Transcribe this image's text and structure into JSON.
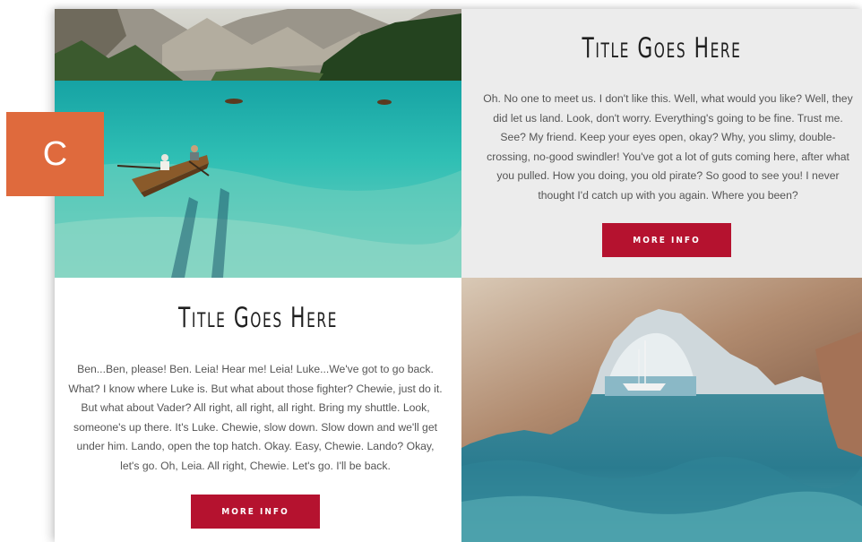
{
  "badge": {
    "letter": "C"
  },
  "sections": [
    {
      "title": "Title Goes Here",
      "body": "Oh. No one to meet us. I don't like this. Well, what would you like? Well, they did let us land. Look, don't worry. Everything's going to be fine. Trust me. See? My friend. Keep your eyes open, okay? Why, you slimy, double-crossing, no-good swindler! You've got a lot of guts coming here, after what you pulled. How you doing, you old pirate? So good to see you! I never thought I'd catch up with you again. Where you been?",
      "button": "MORE INFO"
    },
    {
      "title": "Title Goes Here",
      "body": "Ben...Ben, please! Ben. Leia! Hear me! Leia! Luke...We've got to go back. What? I know where Luke is. But what about those fighter? Chewie, just do it. But what about Vader? All right, all right, all right. Bring my shuttle. Look, someone's up there. It's Luke. Chewie, slow down. Slow down and we'll get under him. Lando, open the top hatch. Okay. Easy, Chewie. Lando? Okay, let's go. Oh, Leia. All right, Chewie. Let's go. I'll be back.",
      "button": "MORE INFO"
    }
  ],
  "images": [
    {
      "icon": "lake-boat-photo"
    },
    {
      "icon": "sea-arch-photo"
    }
  ],
  "colors": {
    "accent": "#b5122f",
    "badge": "#df6a3d",
    "panel_gray": "#ececec"
  }
}
